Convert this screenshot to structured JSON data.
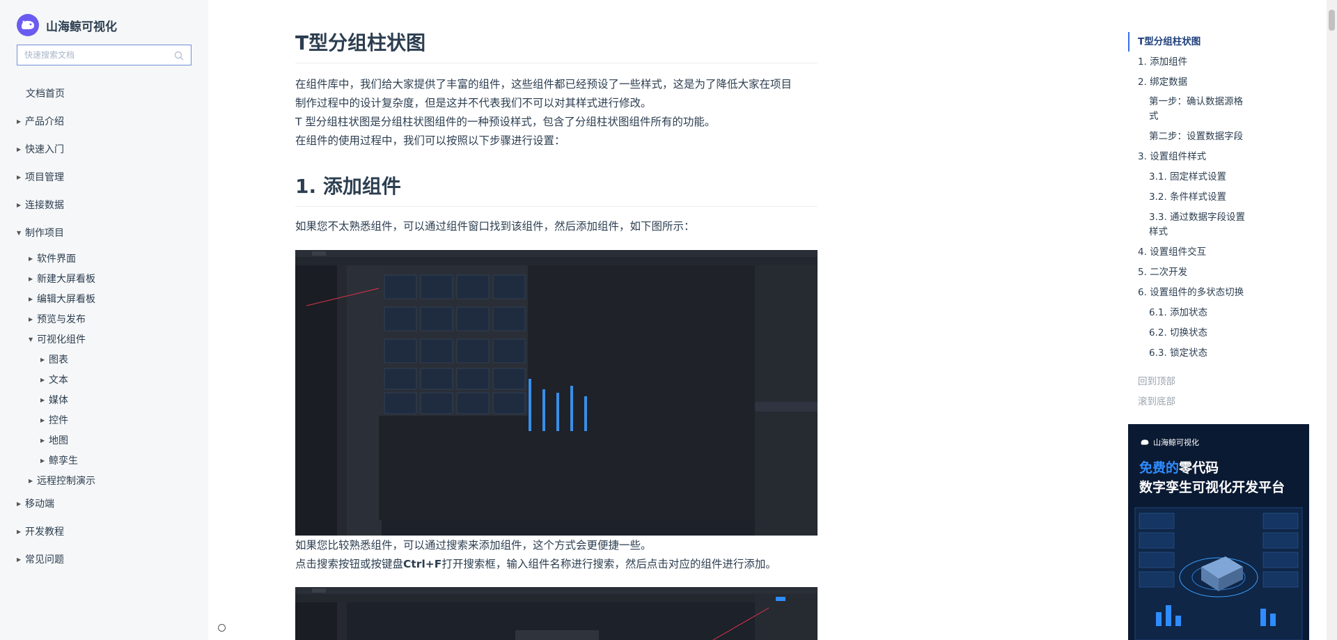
{
  "brand": {
    "name": "山海鲸可视化"
  },
  "search": {
    "placeholder": "快速搜索文档"
  },
  "sidebar": {
    "items": [
      {
        "label": "文档首页"
      },
      {
        "label": "产品介绍"
      },
      {
        "label": "快速入门"
      },
      {
        "label": "项目管理"
      },
      {
        "label": "连接数据"
      },
      {
        "label": "制作项目"
      },
      {
        "label": "软件界面"
      },
      {
        "label": "新建大屏看板"
      },
      {
        "label": "编辑大屏看板"
      },
      {
        "label": "预览与发布"
      },
      {
        "label": "可视化组件"
      },
      {
        "label": "图表"
      },
      {
        "label": "文本"
      },
      {
        "label": "媒体"
      },
      {
        "label": "控件"
      },
      {
        "label": "地图"
      },
      {
        "label": "鲸孪生"
      },
      {
        "label": "远程控制演示"
      },
      {
        "label": "移动端"
      },
      {
        "label": "开发教程"
      },
      {
        "label": "常见问题"
      }
    ]
  },
  "article": {
    "title": "T型分组柱状图",
    "intro": [
      "在组件库中，我们给大家提供了丰富的组件，这些组件都已经预设了一些样式，这是为了降低大家在项目",
      "制作过程中的设计复杂度，但是这并不代表我们不可以对其样式进行修改。",
      "T 型分组柱状图是分组柱状图组件的一种预设样式，包含了分组柱状图组件所有的功能。",
      "在组件的使用过程中，我们可以按照以下步骤进行设置："
    ],
    "section1_title": "1. 添加组件",
    "section1_text": "如果您不太熟悉组件，可以通过组件窗口找到该组件，然后添加组件，如下图所示：",
    "after_shot": [
      "如果您比较熟悉组件，可以通过搜索来添加组件，这个方式会更便捷一些。",
      "点击搜索按钮或按键盘",
      "Ctrl+F",
      "打开搜索框，输入组件名称进行搜索，然后点击对应的组件进行添加。"
    ]
  },
  "toc": {
    "items": [
      {
        "label": "T型分组柱状图"
      },
      {
        "label": "1. 添加组件"
      },
      {
        "label": "2. 绑定数据"
      },
      {
        "label": "第一步：确认数据源格"
      },
      {
        "label": "式"
      },
      {
        "label": "第二步：设置数据字段"
      },
      {
        "label": "3. 设置组件样式"
      },
      {
        "label": "3.1. 固定样式设置"
      },
      {
        "label": "3.2. 条件样式设置"
      },
      {
        "label": "3.3. 通过数据字段设置"
      },
      {
        "label": "样式"
      },
      {
        "label": "4. 设置组件交互"
      },
      {
        "label": "5. 二次开发"
      },
      {
        "label": "6. 设置组件的多状态切换"
      },
      {
        "label": "6.1. 添加状态"
      },
      {
        "label": "6.2. 切换状态"
      },
      {
        "label": "6.3. 锁定状态"
      }
    ],
    "back_top": "回到顶部",
    "to_bottom": "滚到底部"
  },
  "ad": {
    "brand": "山海鲸可视化",
    "line1_highlight": "免费的",
    "line1_rest": "零代码",
    "line2": "数字孪生可视化开发平台"
  },
  "colors": {
    "accent": "#3a6ee8",
    "highlight": "#2f8cff",
    "screenshot_bg": "#1d2129"
  }
}
